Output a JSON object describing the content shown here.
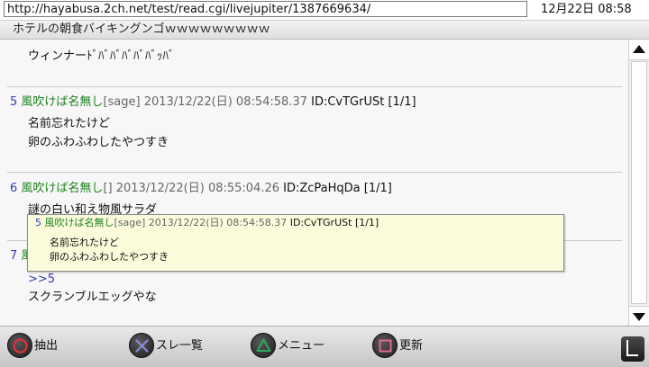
{
  "browser": {
    "url": "http://hayabusa.2ch.net/test/read.cgi/livejupiter/1387669634/",
    "clock": "12月22日 08:58"
  },
  "thread": {
    "title": "ホテルの朝食バイキングンゴｗｗｗｗｗｗｗｗｗ"
  },
  "posts": [
    {
      "body": [
        "ウィンナーﾄﾞﾊﾞﾊﾞﾊﾞﾊﾞﾊﾞｯﾊﾞ"
      ]
    },
    {
      "num": "5",
      "name": "風吹けば名無し",
      "mail": "[sage]",
      "date": "2013/12/22(日) 08:54:58.37",
      "id": "ID:CvTGrUSt",
      "count": "[1/1]",
      "body": [
        "名前忘れたけど",
        "卵のふわふわしたやつすき"
      ]
    },
    {
      "num": "6",
      "name": "風吹けば名無し",
      "mail": "[]",
      "date": "2013/12/22(日) 08:55:04.26",
      "id": "ID:ZcPaHqDa",
      "count": "[1/1]",
      "body": [
        "謎の白い和え物風サラダ"
      ]
    },
    {
      "num": "7",
      "name": "風",
      "anchor": ">>5",
      "body": [
        "スクランブルエッグやな"
      ]
    }
  ],
  "popup": {
    "num": "5",
    "name": "風吹けば名無し",
    "mail": "[sage]",
    "date": "2013/12/22(日) 08:54:58.37",
    "id": "ID:CvTGrUSt",
    "count": "[1/1]",
    "body": [
      "名前忘れたけど",
      "卵のふわふわしたやつすき"
    ]
  },
  "controls": {
    "circle_label": "抽出",
    "cross_label": "スレ一覧",
    "triangle_label": "メニュー",
    "square_label": "更新",
    "circle_icon": "circle-button-icon",
    "cross_icon": "cross-button-icon",
    "triangle_icon": "triangle-button-icon",
    "square_icon": "square-button-icon",
    "l_icon": "l-shoulder-button-icon"
  },
  "colors": {
    "name": "#208020",
    "number": "#3a3ab0",
    "meta": "#666666",
    "popup_bg": "#fbfbdc",
    "circle": "#e0323c",
    "cross": "#8a8ad8",
    "triangle": "#2faa5a",
    "square": "#e06a8a"
  }
}
